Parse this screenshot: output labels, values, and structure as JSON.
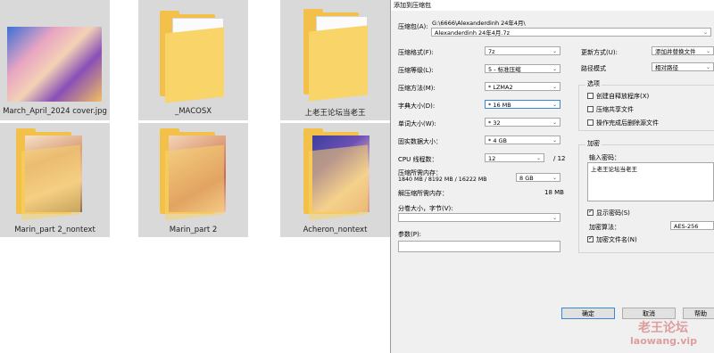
{
  "explorer": {
    "items": [
      {
        "name": "March_April_2024 cover.jpg",
        "type": "image"
      },
      {
        "name": "_MACOSX",
        "type": "folder"
      },
      {
        "name": "上老王论坛当老王",
        "type": "folder"
      },
      {
        "name": "Marin_part 2_nontext",
        "type": "folder-photo"
      },
      {
        "name": "Marin_part 2",
        "type": "folder-photo"
      },
      {
        "name": "Acheron_nontext",
        "type": "folder-photo"
      }
    ]
  },
  "dialog": {
    "title": "添加到压缩包",
    "archive_label": "压缩包(A):",
    "archive_path": "G:\\6666\\Alexanderdinh 24年4月\\",
    "archive_name": "Alexanderdinh 24年4月.7z",
    "format_label": "压缩格式(F):",
    "format_value": "7z",
    "level_label": "压缩等级(L):",
    "level_value": "5 - 标准压缩",
    "method_label": "压缩方法(M):",
    "method_value": "* LZMA2",
    "dict_label": "字典大小(D):",
    "dict_value": "* 16 MB",
    "word_label": "单词大小(W):",
    "word_value": "* 32",
    "solid_label": "固实数据大小：",
    "solid_value": "* 4 GB",
    "cpu_label": "CPU 线程数：",
    "cpu_value": "12",
    "cpu_total": "/ 12",
    "mem_label": "压缩所需内存：",
    "mem_detail": "1840 MB / 8192 MB / 16222 MB",
    "mem_select": "8 GB",
    "decomp_label": "解压缩所需内存：",
    "decomp_value": "18 MB",
    "split_label": "分卷大小，字节(V):",
    "split_value": "",
    "params_label": "参数(P):",
    "params_value": "",
    "update_label": "更新方式(U):",
    "update_value": "添加并替换文件",
    "path_label": "路径模式",
    "path_value": "相对路径",
    "options_title": "选项",
    "opt_sfx": "创建自释放程序(X)",
    "opt_shared": "压缩共享文件",
    "opt_delete": "操作完成后删除源文件",
    "encrypt_title": "加密",
    "password_label": "输入密码：",
    "password_value": "上老王论坛当老王",
    "show_password": "显示密码(S)",
    "enc_method_label": "加密算法：",
    "enc_method_value": "AES-256",
    "enc_names": "加密文件名(N)",
    "ok": "确定",
    "cancel": "取消",
    "help": "帮助"
  },
  "watermark": {
    "line1": "老王论坛",
    "line2": "laowang.vip"
  }
}
